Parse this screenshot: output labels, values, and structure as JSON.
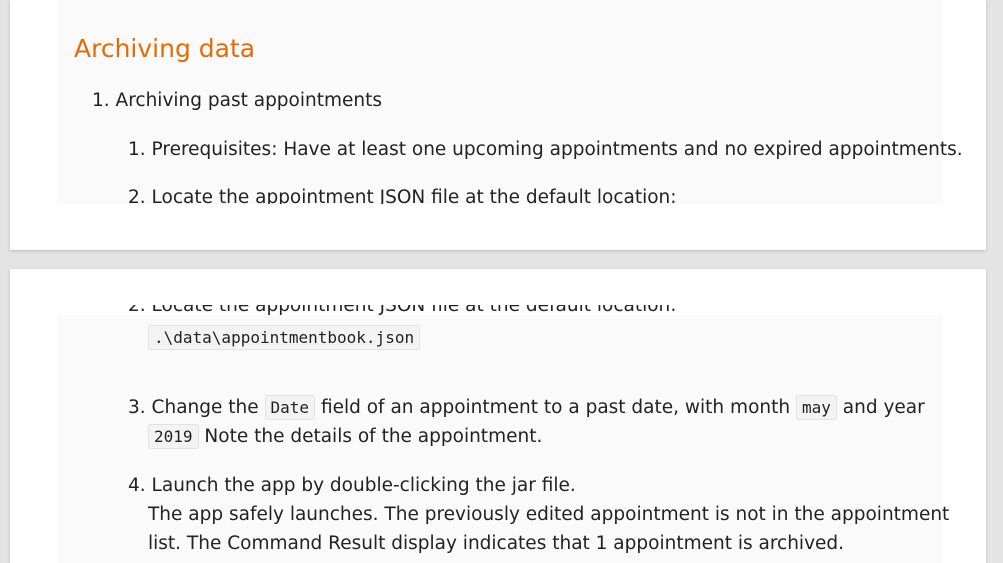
{
  "heading": "Archiving data",
  "item1": {
    "num": "1.",
    "text": "Archiving past appointments"
  },
  "step1": {
    "num": "1.",
    "text": "Prerequisites: Have at least one upcoming appointments and no expired appointments."
  },
  "step2": {
    "num": "2.",
    "text": "Locate the appointment JSON file at the default location:",
    "path": ".\\data\\appointmentbook.json"
  },
  "step3": {
    "num": "3.",
    "text_a": "Change the",
    "code_field": "Date",
    "text_b": "field of an appointment to a past date, with month",
    "code_month": "may",
    "text_c": "and year",
    "code_year": "2019",
    "text_d": "Note the details of the appointment."
  },
  "step4": {
    "num": "4.",
    "text": "Launch the app by double-clicking the jar file.",
    "result_line1": "The app safely launches. The previously edited appointment is not in the appointment",
    "result_line2": "list. The Command Result display indicates that 1 appointment is archived."
  }
}
